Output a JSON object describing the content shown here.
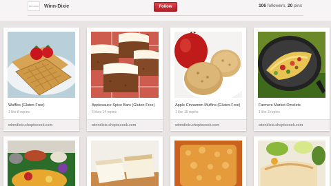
{
  "profile": {
    "thumb_text": "Winn-Dixie",
    "name": "Winn-Dixie",
    "follow_label": "Follow",
    "followers_count": "106",
    "followers_label": "followers,",
    "pins_count": "20",
    "pins_label": "pins"
  },
  "pins": [
    {
      "title": "Waffles (Gluten-Free)",
      "meta": "1 like   8 repins",
      "source": "winndixie.shoptocook.com"
    },
    {
      "title": "Applesauce Spice Bars (Gluten-Free)",
      "meta": "5 likes   14 repins",
      "source": "winndixie.shoptocook.com"
    },
    {
      "title": "Apple Cinnamon Muffins (Gluten-Free)",
      "meta": "1 like   15 repins",
      "source": "winndixie.shoptocook.com"
    },
    {
      "title": "Farmers Market Omelets",
      "meta": "1 like   3 repins",
      "source": "winndixie.shoptocook.com"
    }
  ],
  "colors": {
    "follow": "#cb2027",
    "background": "#e8e4e4"
  }
}
